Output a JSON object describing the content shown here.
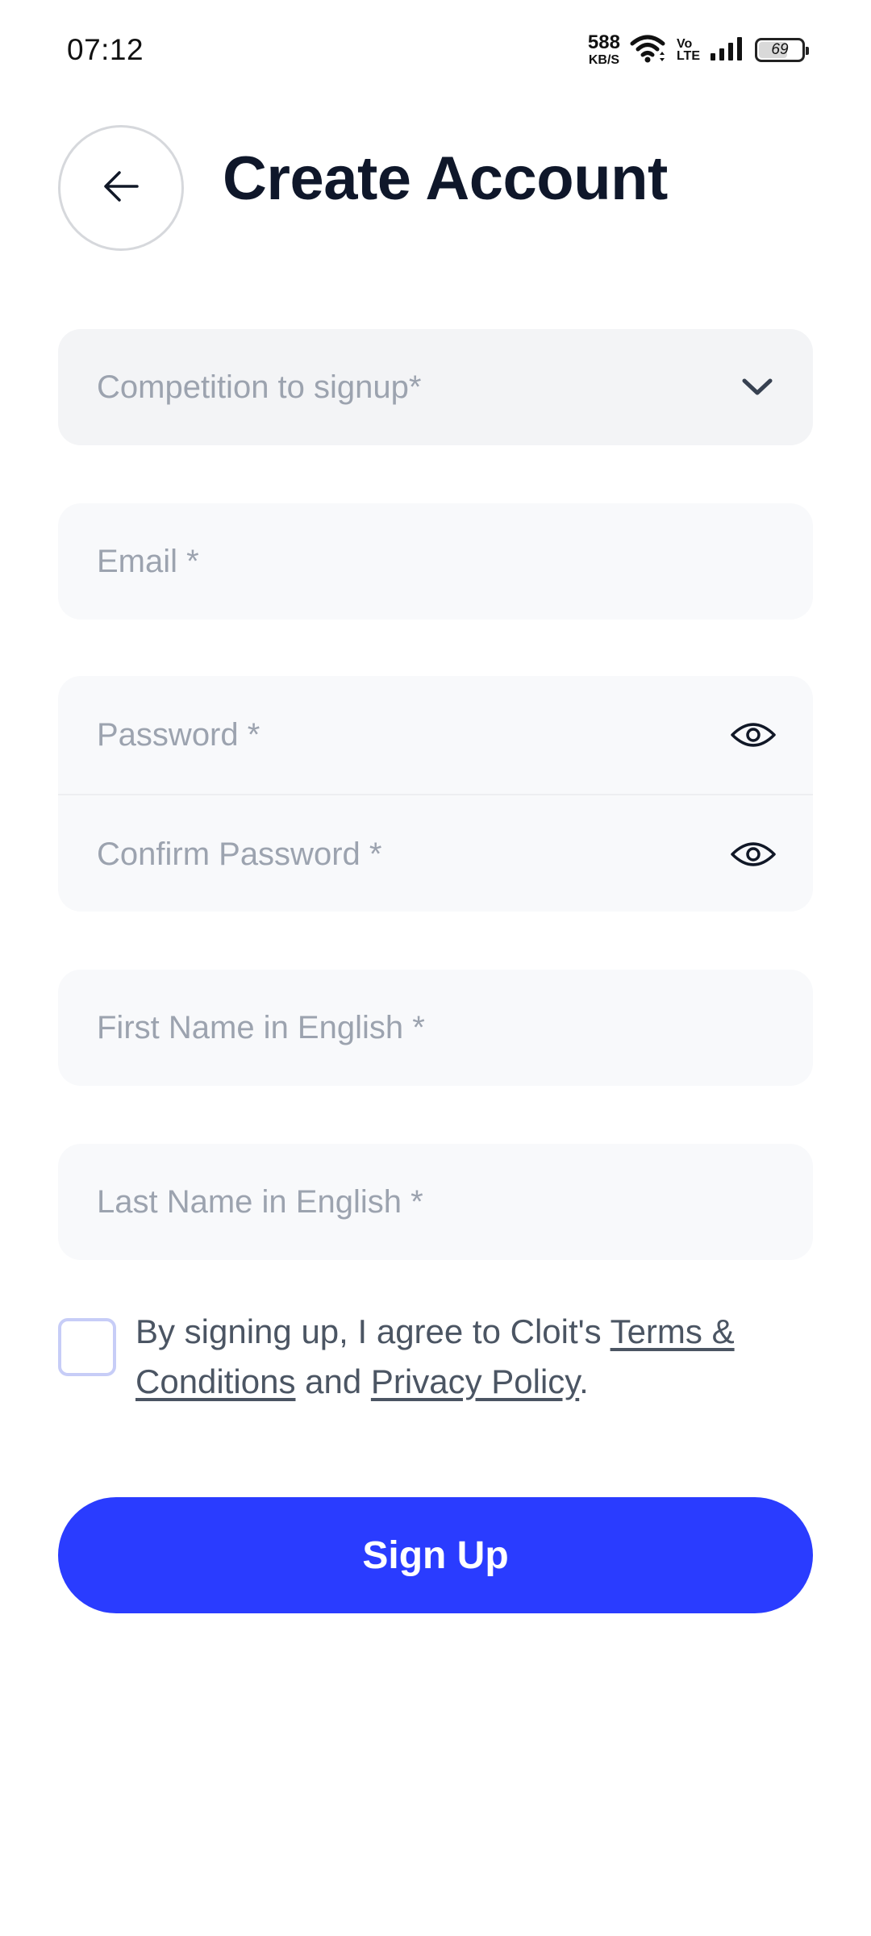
{
  "status_bar": {
    "time": "07:12",
    "net_speed_value": "588",
    "net_speed_unit": "KB/S",
    "volte_top": "Vo",
    "volte_bottom": "LTE",
    "battery_level": "69",
    "battery_fraction": 0.69,
    "icons": [
      "wifi-icon",
      "volte-icon",
      "signal-icon",
      "battery-icon"
    ]
  },
  "header": {
    "back_icon": "arrow-left-icon",
    "title": "Create Account"
  },
  "form": {
    "competition": {
      "placeholder": "Competition to signup*",
      "icon": "chevron-down-icon"
    },
    "email": {
      "placeholder": "Email *"
    },
    "password": {
      "placeholder": "Password *",
      "icon": "eye-icon"
    },
    "confirm_password": {
      "placeholder": "Confirm Password *",
      "icon": "eye-icon"
    },
    "first_name": {
      "placeholder": "First Name in English *"
    },
    "last_name": {
      "placeholder": "Last Name in English *"
    }
  },
  "terms": {
    "prefix": "By signing up, I agree to Cloit's ",
    "terms_link": "Terms & Conditions",
    "middle": " and ",
    "privacy_link": "Privacy Policy",
    "suffix": "."
  },
  "signup_button": {
    "label": "Sign Up"
  },
  "colors": {
    "primary": "#2a3cff",
    "title": "#0f172a",
    "placeholder": "#9ca3af",
    "field_bg": "#f8f9fb",
    "checkbox_border": "#c7cdf7"
  }
}
